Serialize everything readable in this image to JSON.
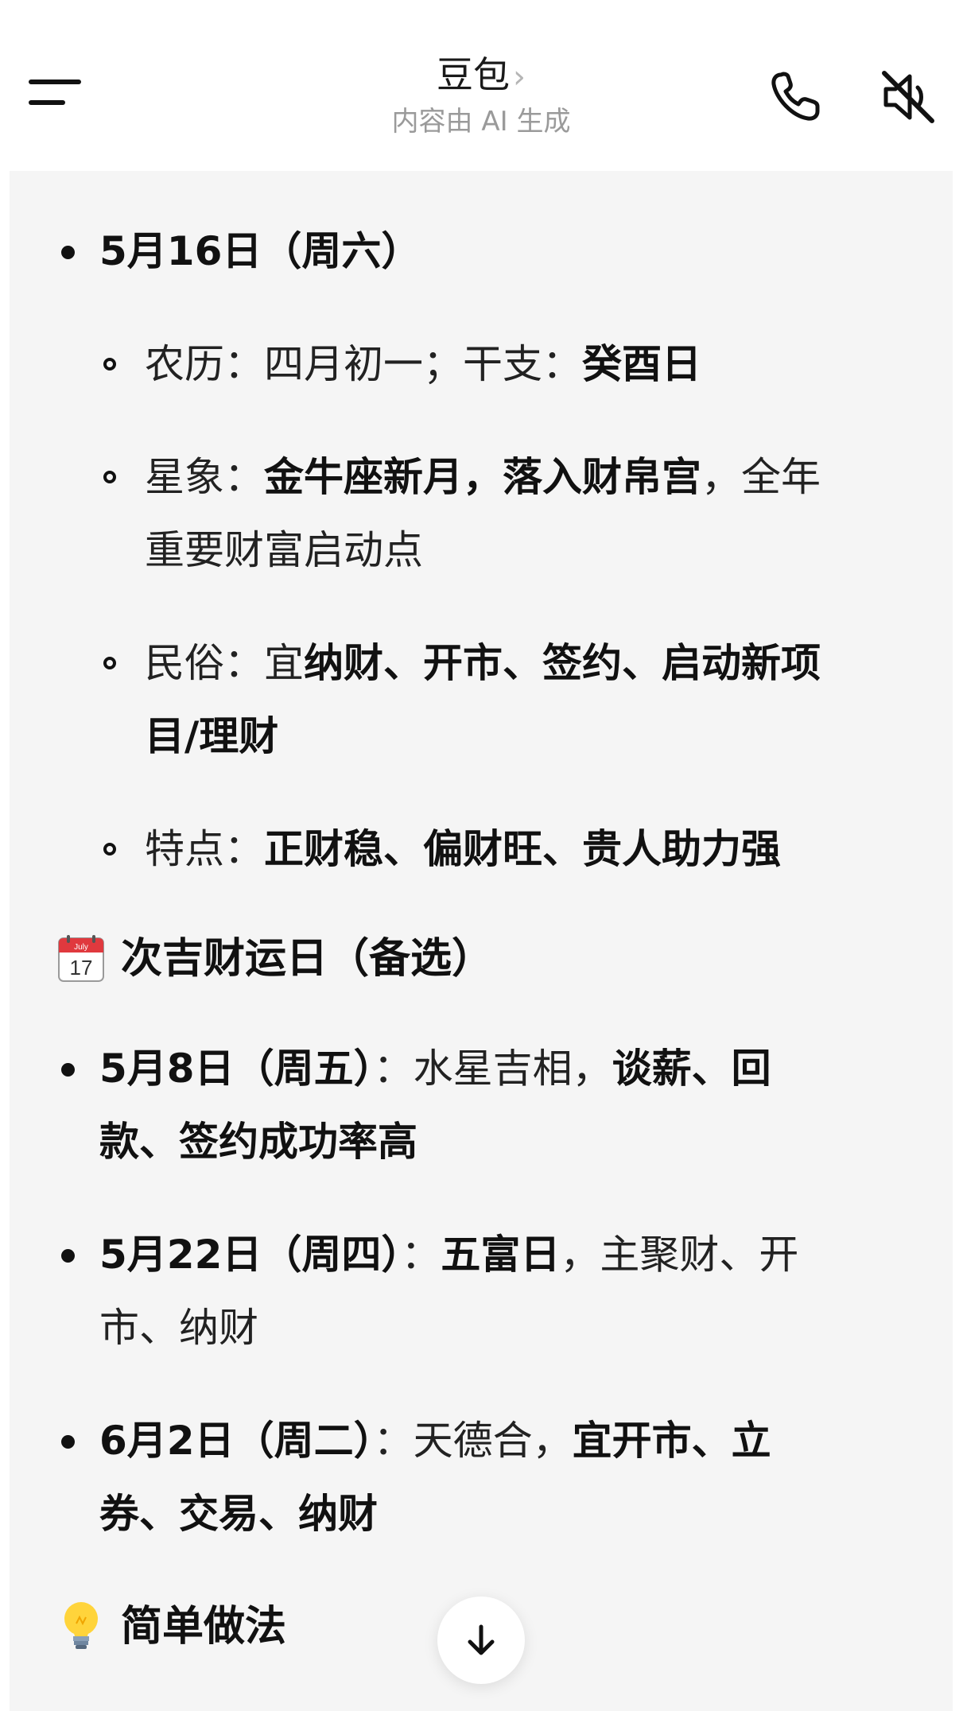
{
  "header": {
    "title": "豆包",
    "title_chevron": "›",
    "subtitle": "内容由 AI 生成",
    "menu_icon": "hamburger-menu-icon",
    "call_icon": "phone-icon",
    "mute_icon": "speaker-muted-icon"
  },
  "main_day": {
    "date": "5月16日（周六）",
    "details": [
      {
        "label": "农历：",
        "plain": "四月初一；干支：",
        "bold": "癸酉日"
      },
      {
        "label": "星象：",
        "bold": "金牛座新月，落入财帛宫",
        "plain_after": "，全年",
        "line2": "重要财富启动点"
      },
      {
        "label": "民俗：",
        "plain": "宜",
        "bold": "纳财、开市、签约、启动新项",
        "line2_bold": "目/理财"
      },
      {
        "label": "特点：",
        "bold": "正财稳、偏财旺、贵人助力强"
      }
    ]
  },
  "alt_section": {
    "icon": "calendar-icon",
    "icon_month": "July",
    "icon_day": "17",
    "title": "次吉财运日（备选）",
    "items": [
      {
        "date": "5月8日（周五）",
        "sep": "：",
        "plain": "水星吉相，",
        "bold": "谈薪、回",
        "line2_bold": "款、签约成功率高"
      },
      {
        "date": "5月22日（周四）",
        "sep": "：",
        "bold": "五富日",
        "plain": "，主聚财、开",
        "line2_plain": "市、纳财"
      },
      {
        "date": "6月2日（周二）",
        "sep": "：",
        "plain": "天德合，",
        "bold": "宜开市、立",
        "line2_bold": "券、交易、纳财"
      }
    ]
  },
  "tips_section": {
    "icon": "light-bulb-icon",
    "title": "简单做法"
  },
  "scroll_button": {
    "icon": "arrow-down-icon"
  }
}
